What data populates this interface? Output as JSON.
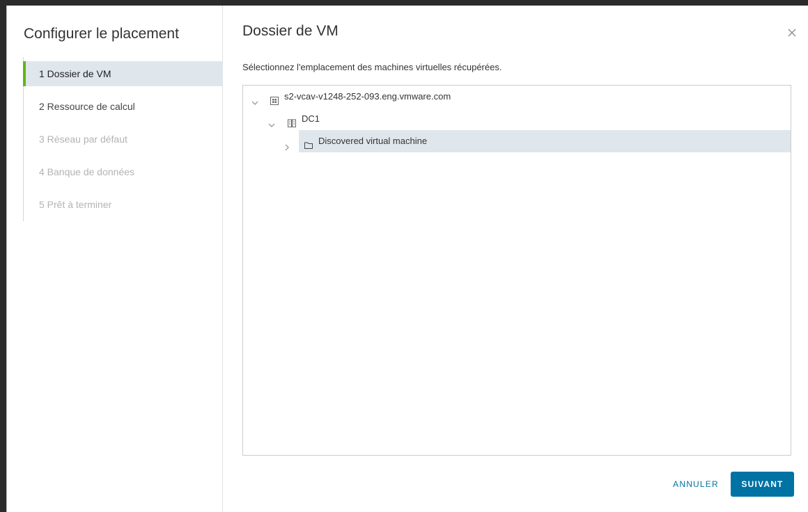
{
  "wizard": {
    "title": "Configurer le placement",
    "steps": [
      {
        "label": "1  Dossier de VM",
        "state": "active"
      },
      {
        "label": "2  Ressource de calcul",
        "state": "enabled"
      },
      {
        "label": "3  Réseau par défaut",
        "state": "disabled"
      },
      {
        "label": "4  Banque de données",
        "state": "disabled"
      },
      {
        "label": "5  Prêt à terminer",
        "state": "disabled"
      }
    ]
  },
  "main": {
    "title": "Dossier de VM",
    "instruction": "Sélectionnez l'emplacement des machines virtuelles récupérées.",
    "close_icon": "close-icon"
  },
  "tree": {
    "nodes": [
      {
        "label": "s2-vcav-v1248-252-093.eng.vmware.com",
        "icon": "vcenter-icon",
        "expanded": true,
        "selected": false
      },
      {
        "label": "DC1",
        "icon": "datacenter-icon",
        "expanded": true,
        "selected": false
      },
      {
        "label": "Discovered virtual machine",
        "icon": "folder-icon",
        "expanded": false,
        "selected": true
      }
    ]
  },
  "footer": {
    "cancel_label": "ANNULER",
    "next_label": "SUIVANT"
  },
  "colors": {
    "accent": "#0072a3",
    "active_step_marker": "#61b715",
    "selection_bg": "#dfe6ec"
  }
}
